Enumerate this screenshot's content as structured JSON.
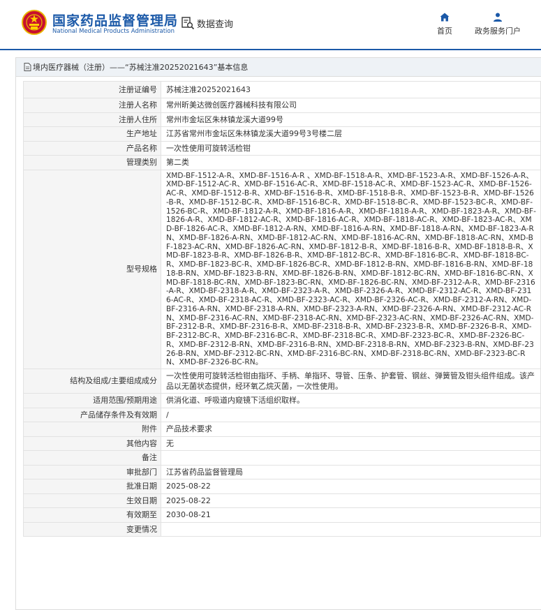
{
  "header": {
    "brand_cn": "国家药品监督管理局",
    "brand_en": "National Medical Products Administration",
    "query_label": "数据查询",
    "nav": [
      {
        "label": "首页",
        "icon": "home-icon"
      },
      {
        "label": "政务服务门户",
        "icon": "user-icon"
      }
    ]
  },
  "colors": {
    "brand": "#1b59a8",
    "title_bg": "#eef2f6",
    "key_bg": "#f5f5f5",
    "border": "#e2e2e2"
  },
  "panel": {
    "title": "境内医疗器械（注册）——“苏械注准20252021643”基本信息"
  },
  "fields": [
    {
      "key": "注册证编号",
      "value": "苏械注准20252021643"
    },
    {
      "key": "注册人名称",
      "value": "常州昕美达微创医疗器械科技有限公司"
    },
    {
      "key": "注册人住所",
      "value": "常州市金坛区朱林镇龙溪大道99号"
    },
    {
      "key": "生产地址",
      "value": "江苏省常州市金坛区朱林镇龙溪大道99号3号楼二层"
    },
    {
      "key": "产品名称",
      "value": "一次性使用可旋转活检钳"
    },
    {
      "key": "管理类别",
      "value": "第二类"
    },
    {
      "key": "型号规格",
      "value": "XMD-BF-1512-A-R、XMD-BF-1516-A-R 、XMD-BF-1518-A-R、XMD-BF-1523-A-R、XMD-BF-1526-A-R、XMD-BF-1512-AC-R、XMD-BF-1516-AC-R、XMD-BF-1518-AC-R、XMD-BF-1523-AC-R、XMD-BF-1526-AC-R、XMD-BF-1512-B-R、XMD-BF-1516-B-R、XMD-BF-1518-B-R、XMD-BF-1523-B-R、XMD-BF-1526-B-R、XMD-BF-1512-BC-R、XMD-BF-1516-BC-R、XMD-BF-1518-BC-R、XMD-BF-1523-BC-R、XMD-BF-1526-BC-R、XMD-BF-1812-A-R、XMD-BF-1816-A-R、XMD-BF-1818-A-R、XMD-BF-1823-A-R、XMD-BF-1826-A-R、XMD-BF-1812-AC-R、XMD-BF-1816-AC-R、XMD-BF-1818-AC-R、XMD-BF-1823-AC-R、XMD-BF-1826-AC-R、XMD-BF-1812-A-RN、XMD-BF-1816-A-RN、XMD-BF-1818-A-RN、XMD-BF-1823-A-RN、XMD-BF-1826-A-RN、XMD-BF-1812-AC-RN、XMD-BF-1816-AC-RN、XMD-BF-1818-AC-RN、XMD-BF-1823-AC-RN、XMD-BF-1826-AC-RN、XMD-BF-1812-B-R、XMD-BF-1816-B-R、XMD-BF-1818-B-R、XMD-BF-1823-B-R、XMD-BF-1826-B-R、XMD-BF-1812-BC-R、XMD-BF-1816-BC-R、XMD-BF-1818-BC-R、XMD-BF-1823-BC-R、XMD-BF-1826-BC-R、XMD-BF-1812-B-RN、XMD-BF-1816-B-RN、XMD-BF-1818-B-RN、XMD-BF-1823-B-RN、XMD-BF-1826-B-RN、XMD-BF-1812-BC-RN、XMD-BF-1816-BC-RN、XMD-BF-1818-BC-RN、XMD-BF-1823-BC-RN、XMD-BF-1826-BC-RN、XMD-BF-2312-A-R、XMD-BF-2316-A-R、XMD-BF-2318-A-R、XMD-BF-2323-A-R、XMD-BF-2326-A-R、XMD-BF-2312-AC-R、XMD-BF-2316-AC-R、XMD-BF-2318-AC-R、XMD-BF-2323-AC-R、XMD-BF-2326-AC-R、XMD-BF-2312-A-RN、XMD-BF-2316-A-RN、XMD-BF-2318-A-RN、XMD-BF-2323-A-RN、XMD-BF-2326-A-RN、XMD-BF-2312-AC-RN、XMD-BF-2316-AC-RN、XMD-BF-2318-AC-RN、XMD-BF-2323-AC-RN、XMD-BF-2326-AC-RN、XMD-BF-2312-B-R、XMD-BF-2316-B-R、XMD-BF-2318-B-R、XMD-BF-2323-B-R、XMD-BF-2326-B-R、XMD-BF-2312-BC-R、XMD-BF-2316-BC-R、XMD-BF-2318-BC-R、XMD-BF-2323-BC-R、XMD-BF-2326-BC-R、XMD-BF-2312-B-RN、XMD-BF-2316-B-RN、XMD-BF-2318-B-RN、XMD-BF-2323-B-RN、XMD-BF-2326-B-RN、XMD-BF-2312-BC-RN、XMD-BF-2316-BC-RN、XMD-BF-2318-BC-RN、XMD-BF-2323-BC-RN、XMD-BF-2326-BC-RN。"
    },
    {
      "key": "结构及组成/主要组成成分",
      "value": "一次性使用可旋转活检钳由指环、手柄、单指环、导管、压条、护套管、钢丝、弹簧管及钳头组件组成。该产品以无菌状态提供，经环氧乙烷灭菌，一次性使用。"
    },
    {
      "key": "适用范围/预期用途",
      "value": "供消化道、呼吸道内窥镜下活组织取样。"
    },
    {
      "key": "产品储存条件及有效期",
      "value": "/"
    },
    {
      "key": "附件",
      "value": "产品技术要求"
    },
    {
      "key": "其他内容",
      "value": "无"
    },
    {
      "key": "备注",
      "value": ""
    },
    {
      "key": "审批部门",
      "value": "江苏省药品监督管理局"
    },
    {
      "key": "批准日期",
      "value": "2025-08-22"
    },
    {
      "key": "生效日期",
      "value": "2025-08-22"
    },
    {
      "key": "有效期至",
      "value": "2030-08-21"
    },
    {
      "key": "变更情况",
      "value": ""
    }
  ]
}
